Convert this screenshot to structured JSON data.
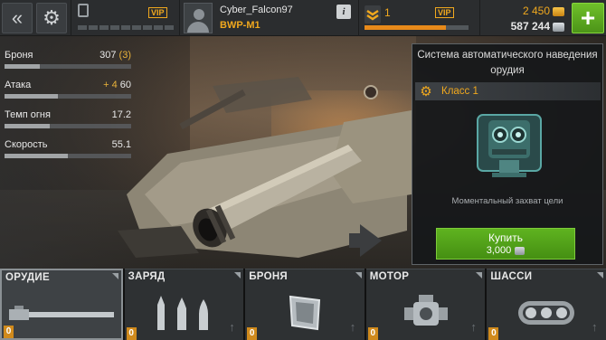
{
  "topbar": {
    "vip_label_1": "VIP",
    "vip_label_2": "VIP",
    "player_name": "Cyber_Falcon97",
    "tank_name": "BWP-M1",
    "info_label": "i",
    "rank_level": "1",
    "xp_progress": 0.78,
    "gold": "2 450",
    "silver": "587 244",
    "add_label": "+",
    "energy_segments_filled": 0
  },
  "stats": [
    {
      "label": "Броня",
      "value": "307",
      "bonus": " (3)",
      "fill": 0.28
    },
    {
      "label": "Атака",
      "value": "60",
      "bonus": "+ 4 ",
      "fill": 0.42
    },
    {
      "label": "Темп огня",
      "value": "17.2",
      "bonus": "",
      "fill": 0.36
    },
    {
      "label": "Скорость",
      "value": "55.1",
      "bonus": "",
      "fill": 0.5
    }
  ],
  "panel": {
    "title": "Система автоматического наведения орудия",
    "class_label": "Класс 1",
    "description": "Моментальный захват цели",
    "buy_label": "Купить",
    "price": "3,000"
  },
  "tabs": [
    {
      "label": "ОРУДИЕ",
      "count": "0"
    },
    {
      "label": "ЗАРЯД",
      "count": "0"
    },
    {
      "label": "БРОНЯ",
      "count": "0"
    },
    {
      "label": "МОТОР",
      "count": "0"
    },
    {
      "label": "ШАССИ",
      "count": "0"
    }
  ],
  "colors": {
    "accent": "#f0a81e",
    "buy_green": "#5fb320",
    "xp_orange": "#e88a1a"
  }
}
